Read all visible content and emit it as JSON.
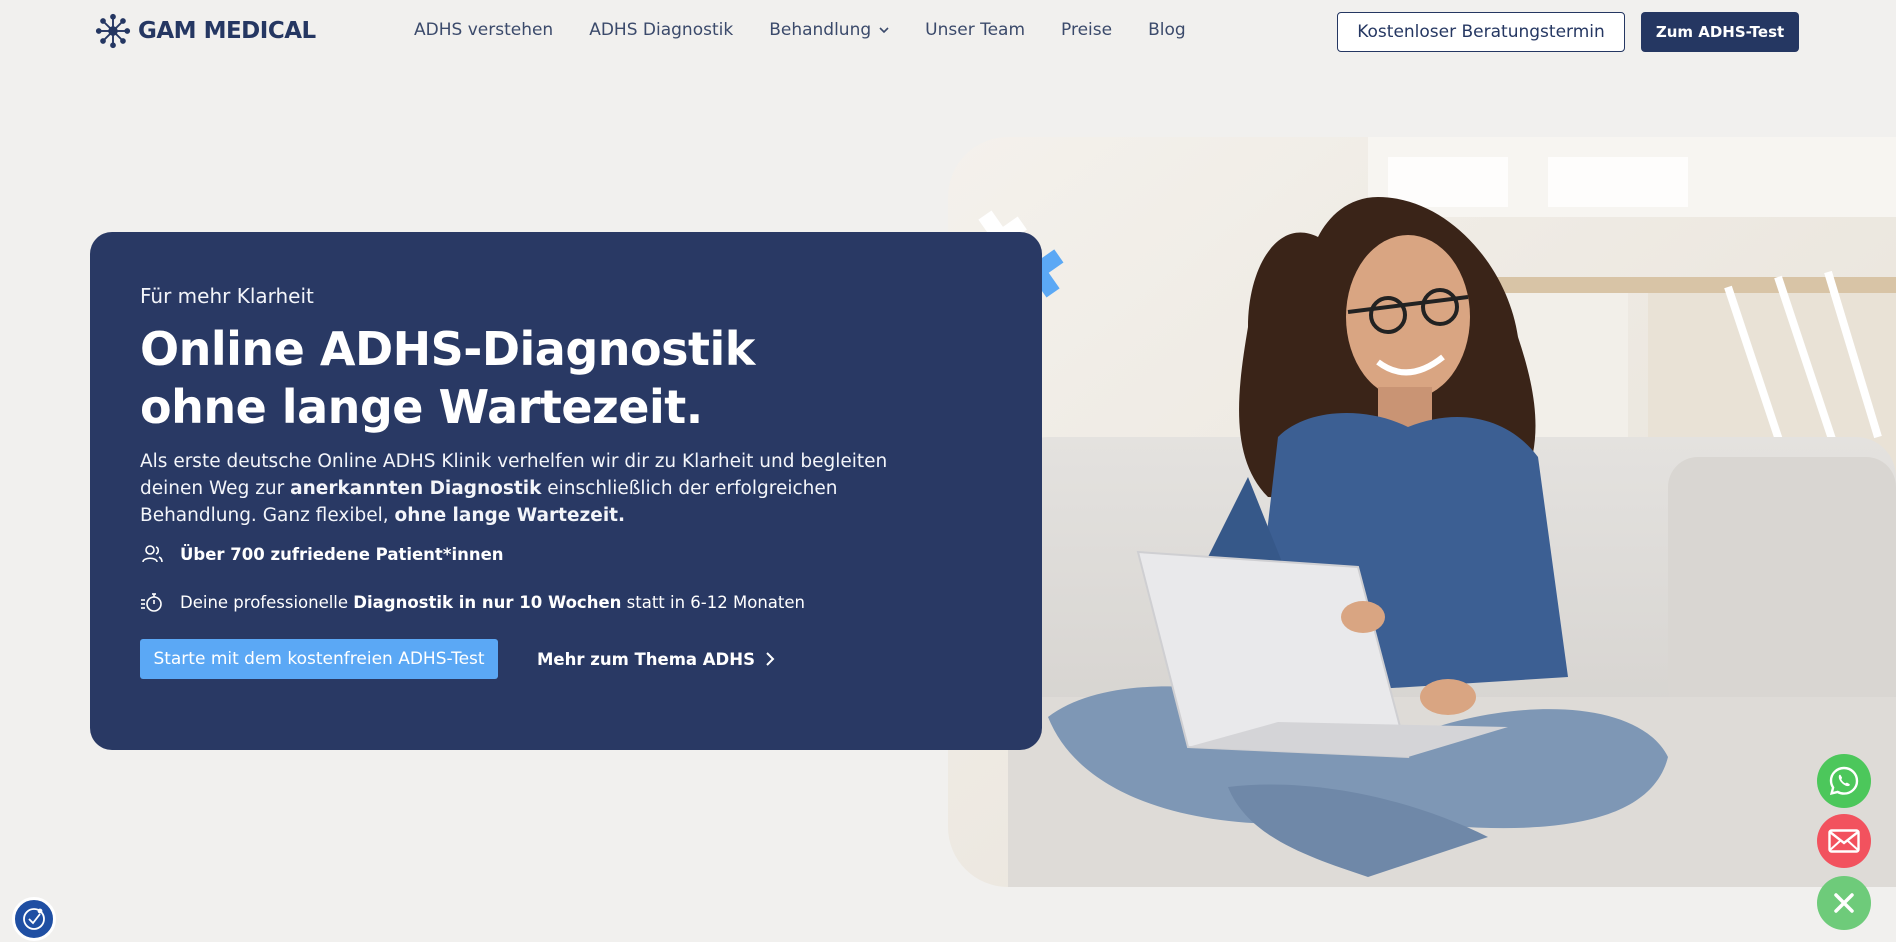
{
  "header": {
    "brand": "GAM MEDICAL",
    "nav": [
      {
        "label": "ADHS verstehen"
      },
      {
        "label": "ADHS Diagnostik"
      },
      {
        "label": "Behandlung"
      },
      {
        "label": "Unser Team"
      },
      {
        "label": "Preise"
      },
      {
        "label": "Blog"
      }
    ],
    "consult_button": "Kostenloser Beratungstermin",
    "test_button": "Zum ADHS-Test"
  },
  "hero": {
    "eyebrow": "Für mehr Klarheit",
    "headline_line1": "Online ADHS-Diagnostik",
    "headline_line2": "ohne lange Wartezeit.",
    "lead_part1": "Als erste deutsche Online ADHS Klinik verhelfen wir dir zu Klarheit und begleiten deinen Weg zur ",
    "lead_bold1": "anerkannten Diagnostik",
    "lead_part2": " einschließlich der erfolgreichen Behandlung. Ganz flexibel, ",
    "lead_bold2": "ohne lange Wartezeit.",
    "feature1_bold": "Über 700 zufriedene Patient*innen",
    "feature2_pre": "Deine professionelle ",
    "feature2_bold": "Diagnostik in nur 10 Wochen",
    "feature2_post": " statt in 6-12 Monaten",
    "cta_primary": "Starte mit dem kostenfreien ADHS-Test",
    "cta_secondary": "Mehr zum Thema ADHS"
  },
  "icons": {
    "logo": "gam-logo-icon",
    "patients": "users-icon",
    "timer": "stopwatch-icon",
    "whatsapp": "whatsapp-icon",
    "mail": "mail-icon",
    "close": "close-icon",
    "accessibility": "accessibility-icon"
  },
  "colors": {
    "navy": "#293964",
    "accent_blue": "#5ba8f5",
    "background": "#f1f0ee",
    "whatsapp": "#4cc75b",
    "mail": "#f2525e"
  }
}
